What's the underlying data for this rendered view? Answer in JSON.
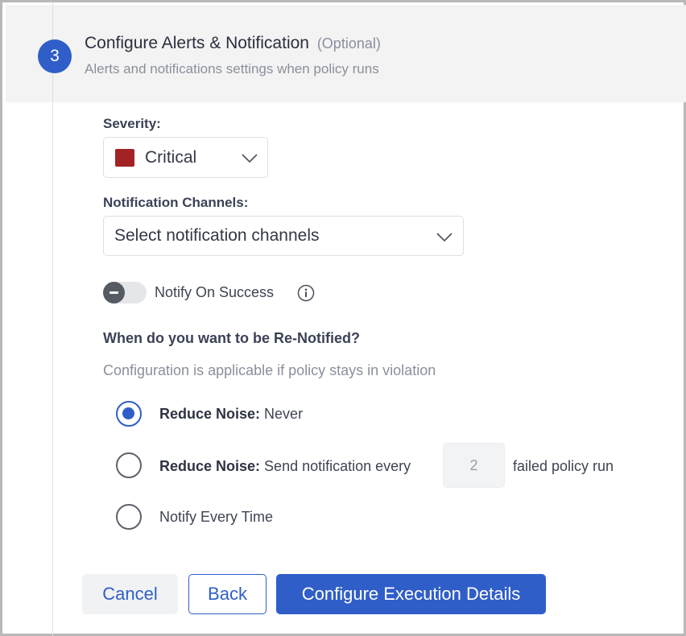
{
  "header": {
    "step_number": "3",
    "title": "Configure Alerts & Notification",
    "optional": "(Optional)",
    "subtitle": "Alerts and notifications settings when policy runs"
  },
  "severity": {
    "label": "Severity:",
    "selected": "Critical",
    "swatch_color": "#a32325"
  },
  "channels": {
    "label": "Notification Channels:",
    "placeholder": "Select notification channels"
  },
  "notify_on_success": {
    "label": "Notify On Success",
    "enabled": false
  },
  "renotify": {
    "question": "When do you want to be Re-Notified?",
    "hint": "Configuration is applicable if policy stays in violation",
    "options": [
      {
        "bold": "Reduce Noise:",
        "text": " Never",
        "selected": true
      },
      {
        "bold": "Reduce Noise:",
        "text": " Send notification every",
        "suffix": "failed policy run",
        "value": "2",
        "selected": false
      },
      {
        "text": "Notify Every Time",
        "selected": false
      }
    ]
  },
  "buttons": {
    "cancel": "Cancel",
    "back": "Back",
    "primary": "Configure Execution Details"
  },
  "colors": {
    "accent": "#2f5ec9",
    "critical": "#a32325"
  }
}
